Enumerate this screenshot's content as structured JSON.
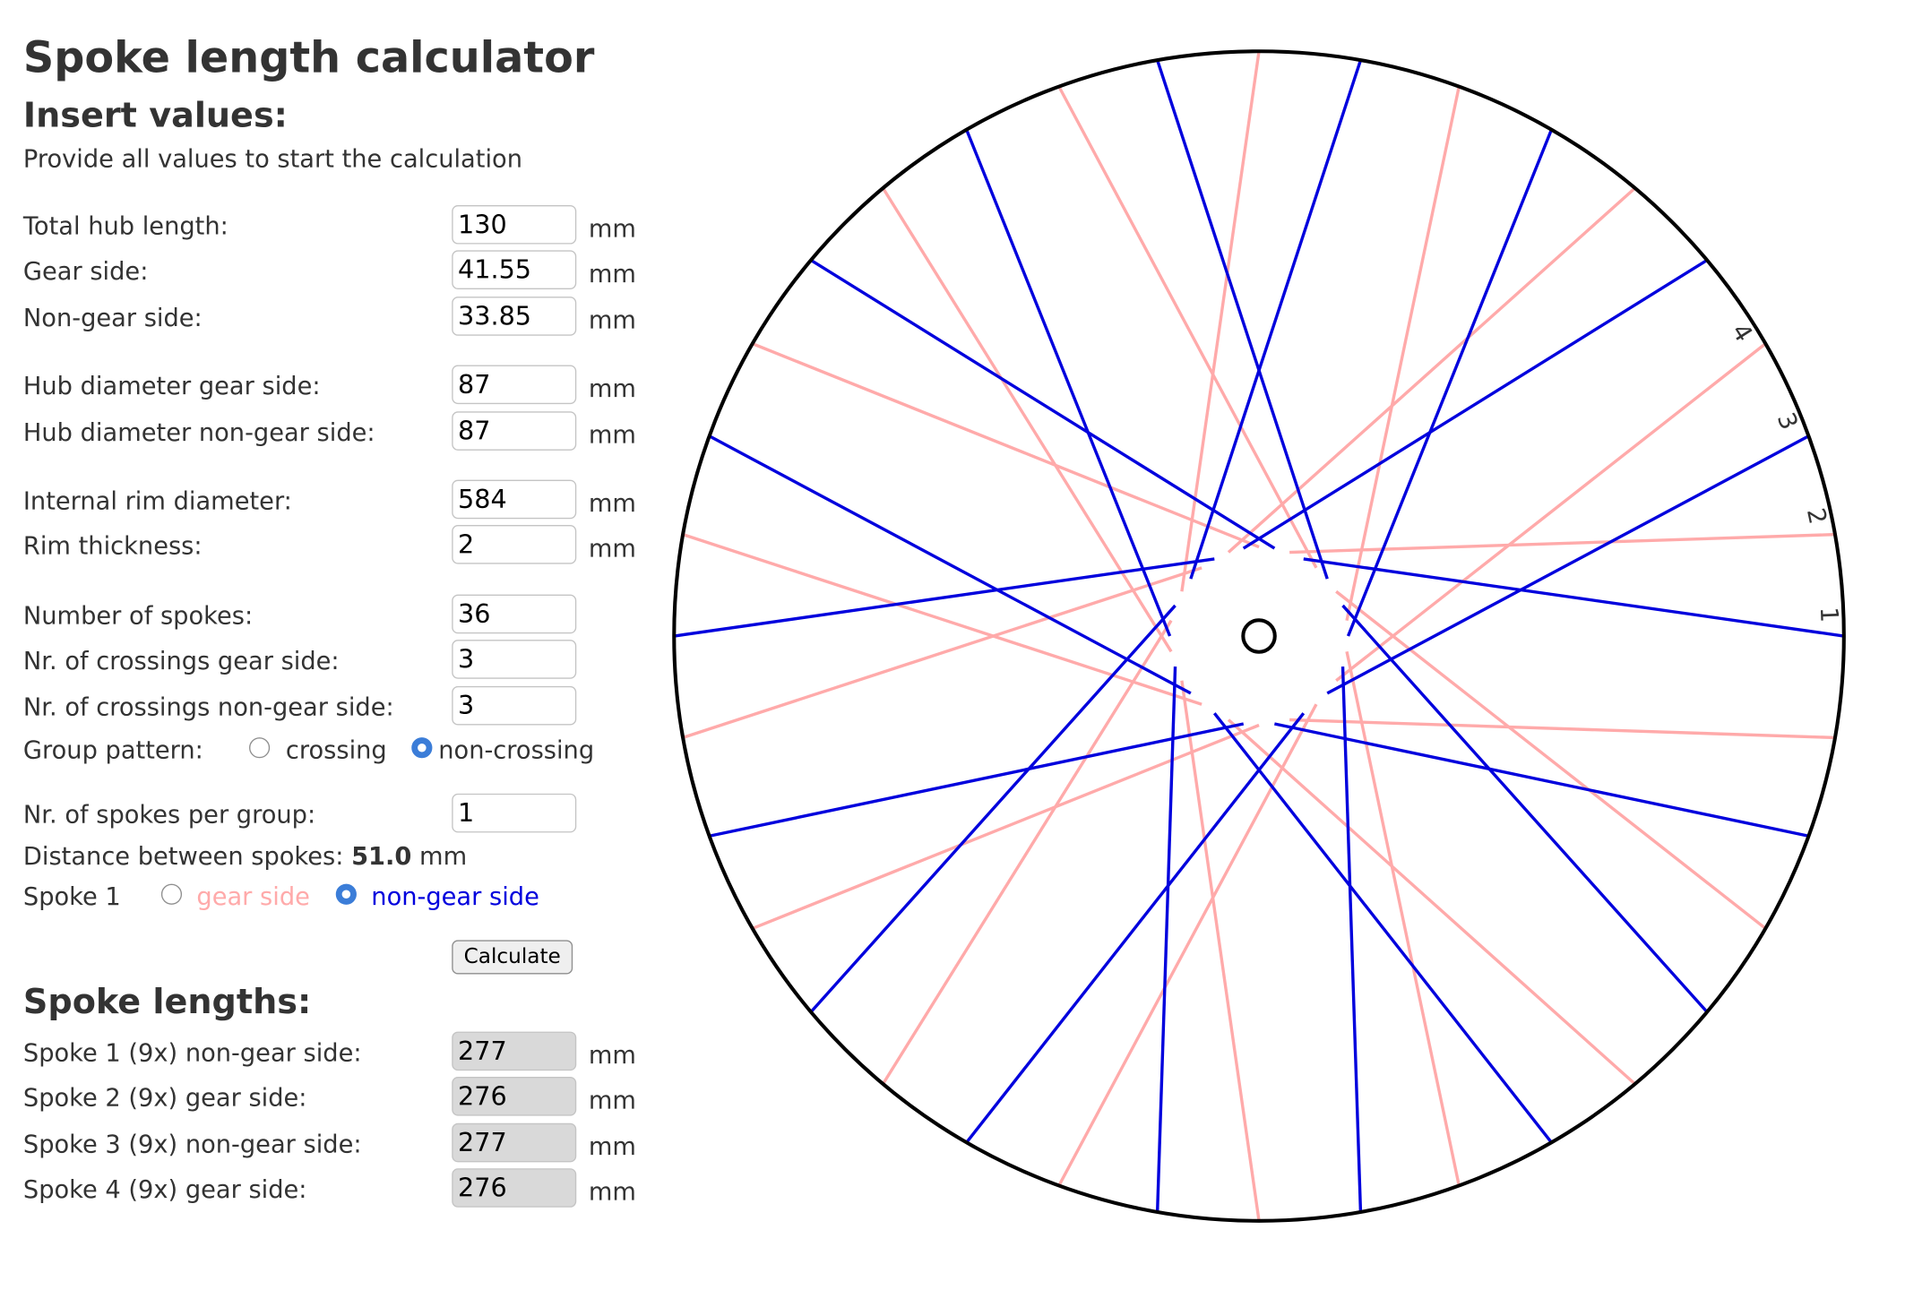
{
  "title": "Spoke length calculator",
  "insert_heading": "Insert values:",
  "hint": "Provide all values to start the calculation",
  "unit": "mm",
  "fields": {
    "total_hub_length": {
      "label": "Total hub length:",
      "value": "130"
    },
    "gear_side": {
      "label": "Gear side:",
      "value": "41.55"
    },
    "non_gear_side": {
      "label": "Non-gear side:",
      "value": "33.85"
    },
    "hub_diameter_gear": {
      "label": "Hub diameter gear side:",
      "value": "87"
    },
    "hub_diameter_non_gear": {
      "label": "Hub diameter non-gear side:",
      "value": "87"
    },
    "internal_rim_diameter": {
      "label": "Internal rim diameter:",
      "value": "584"
    },
    "rim_thickness": {
      "label": "Rim thickness:",
      "value": "2"
    },
    "number_of_spokes": {
      "label": "Number of spokes:",
      "value": "36"
    },
    "crossings_gear": {
      "label": "Nr. of crossings gear side:",
      "value": "3"
    },
    "crossings_non_gear": {
      "label": "Nr. of crossings non-gear side:",
      "value": "3"
    },
    "spokes_per_group": {
      "label": "Nr. of spokes per group:",
      "value": "1"
    }
  },
  "group_pattern": {
    "label": "Group pattern:",
    "options": [
      "crossing",
      "non-crossing"
    ],
    "selected": "non-crossing"
  },
  "distance": {
    "label": "Distance between spokes:",
    "value": "51.0",
    "unit": "mm"
  },
  "spoke1": {
    "label": "Spoke 1",
    "options": [
      "gear side",
      "non-gear side"
    ],
    "selected": "non-gear side"
  },
  "calculate_label": "Calculate",
  "results_heading": "Spoke lengths:",
  "results": [
    {
      "label": "Spoke 1 (9x) non-gear side:",
      "value": "277"
    },
    {
      "label": "Spoke 2 (9x) gear side:",
      "value": "276"
    },
    {
      "label": "Spoke 3 (9x) non-gear side:",
      "value": "277"
    },
    {
      "label": "Spoke 4 (9x) gear side:",
      "value": "276"
    }
  ],
  "wheel": {
    "spoke_count": 36,
    "crossings": 3,
    "spoke_numbers": [
      "1",
      "2",
      "3",
      "4"
    ],
    "colors": {
      "gear_side": "#ffaaaa",
      "non_gear_side": "#0000dd",
      "rim": "#000000",
      "text": "#333333",
      "radio_accent": "#3b7dd8"
    }
  }
}
